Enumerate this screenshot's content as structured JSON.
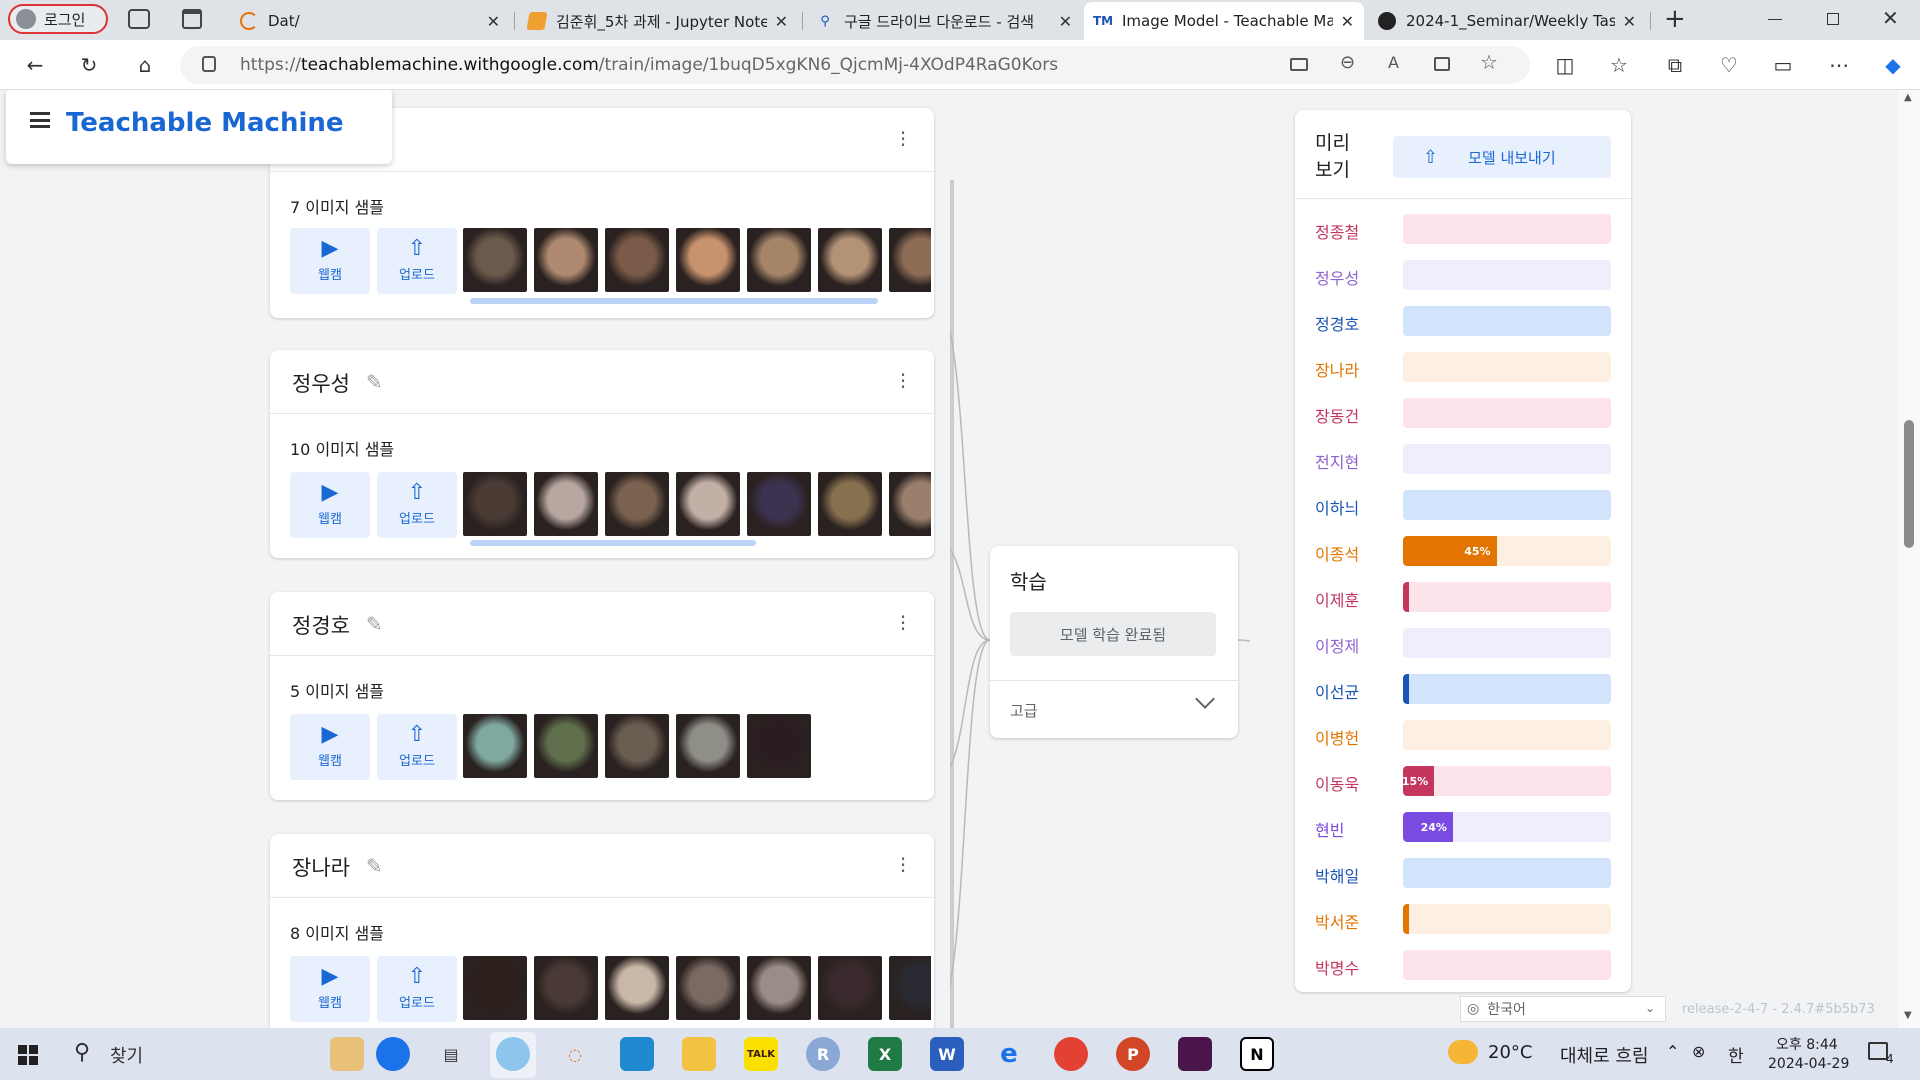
{
  "browser": {
    "profile_label": "로그인",
    "tabs": [
      {
        "title": "Dat/",
        "icon": "loading-icon"
      },
      {
        "title": "김준휘_5차 과제 - Jupyter Note",
        "icon": "jupyter-icon"
      },
      {
        "title": "구글 드라이브 다운로드 - 검색",
        "icon": "search-icon"
      },
      {
        "title": "Image Model - Teachable Mac",
        "icon": "tm-icon",
        "icon_text": "TM"
      },
      {
        "title": "2024-1_Seminar/Weekly Task/",
        "icon": "github-icon"
      }
    ],
    "url_prefix": "https://",
    "url_host": "teachablemachine.withgoogle.com",
    "url_path": "/train/image/1buqD5xgKN6_QjcmMj-4XOdP4RaG0Kors"
  },
  "app": {
    "title": "Teachable Machine"
  },
  "classes": [
    {
      "name": "",
      "samples": "7 이미지 샘플",
      "thumb_colors": [
        "#6b5a4c",
        "#b08a70",
        "#7a5a48",
        "#c9926e",
        "#a58468",
        "#b39276",
        "#8e6c56"
      ]
    },
    {
      "name": "정우성",
      "samples": "10 이미지 샘플",
      "thumb_colors": [
        "#4a3b34",
        "#b7a7a0",
        "#7a6250",
        "#c2b0a6",
        "#3c3250",
        "#87704e",
        "#9a7f6c"
      ]
    },
    {
      "name": "정경호",
      "samples": "5 이미지 샘플",
      "thumb_colors": [
        "#7fa8a0",
        "#5f6f4c",
        "#6a5e52",
        "#8f8f88",
        "#2b1c24"
      ]
    },
    {
      "name": "장나라",
      "samples": "8 이미지 샘플",
      "thumb_colors": [
        "#2c1e1a",
        "#4a3a36",
        "#c9b7a8",
        "#7a6a62",
        "#9a8c86",
        "#3a2a2e",
        "#2a2a32"
      ]
    }
  ],
  "sample_buttons": {
    "webcam": "웹캠",
    "upload": "업로드"
  },
  "training": {
    "title": "학습",
    "button": "모델 학습 완료됨",
    "advanced": "고급"
  },
  "preview": {
    "title_line1": "미리",
    "title_line2": "보기",
    "export_button": "모델 내보내기",
    "rows": [
      {
        "label": "정종철",
        "color": "#c5365e",
        "track": "#fce4ea",
        "value": 0,
        "text": ""
      },
      {
        "label": "정우성",
        "color": "#8d63d2",
        "track": "#f0eefc",
        "value": 0,
        "text": ""
      },
      {
        "label": "정경호",
        "color": "#1a55b5",
        "track": "#d2e3fc",
        "value": 0,
        "text": ""
      },
      {
        "label": "장나라",
        "color": "#e37400",
        "track": "#feefe3",
        "value": 0,
        "text": ""
      },
      {
        "label": "장동건",
        "color": "#c5365e",
        "track": "#fce4ea",
        "value": 0,
        "text": ""
      },
      {
        "label": "전지현",
        "color": "#8d63d2",
        "track": "#f0eefc",
        "value": 0,
        "text": ""
      },
      {
        "label": "이하늬",
        "color": "#1a55b5",
        "track": "#d2e3fc",
        "value": 0,
        "text": ""
      },
      {
        "label": "이종석",
        "color": "#e37400",
        "track": "#feefe3",
        "value": 0.45,
        "text": "45%"
      },
      {
        "label": "이제훈",
        "color": "#c5365e",
        "track": "#fce4ea",
        "value": 0.02,
        "text": ""
      },
      {
        "label": "이정제",
        "color": "#8d63d2",
        "track": "#f0eefc",
        "value": 0,
        "text": ""
      },
      {
        "label": "이선균",
        "color": "#1a55b5",
        "track": "#d2e3fc",
        "value": 0.01,
        "text": ""
      },
      {
        "label": "이병헌",
        "color": "#e37400",
        "track": "#feefe3",
        "value": 0,
        "text": ""
      },
      {
        "label": "이동욱",
        "color": "#c5365e",
        "track": "#fce4ea",
        "value": 0.15,
        "text": "15%"
      },
      {
        "label": "현빈",
        "color": "#7a4be0",
        "track": "#f0eefc",
        "value": 0.24,
        "text": "24%"
      },
      {
        "label": "박해일",
        "color": "#1a55b5",
        "track": "#d2e3fc",
        "value": 0,
        "text": ""
      },
      {
        "label": "박서준",
        "color": "#e37400",
        "track": "#feefe3",
        "value": 0.02,
        "text": ""
      },
      {
        "label": "박명수",
        "color": "#c5365e",
        "track": "#fce4ea",
        "value": 0,
        "text": ""
      }
    ]
  },
  "footer": {
    "language": "한국어",
    "release": "release-2-4-7 - 2.4.7#5b5b73"
  },
  "taskbar": {
    "search": "찾기",
    "weather_temp": "20°C",
    "weather_text": "대체로 흐림",
    "ime": "한",
    "time": "오후 8:44",
    "date": "2024-04-29",
    "notifications": "4"
  }
}
